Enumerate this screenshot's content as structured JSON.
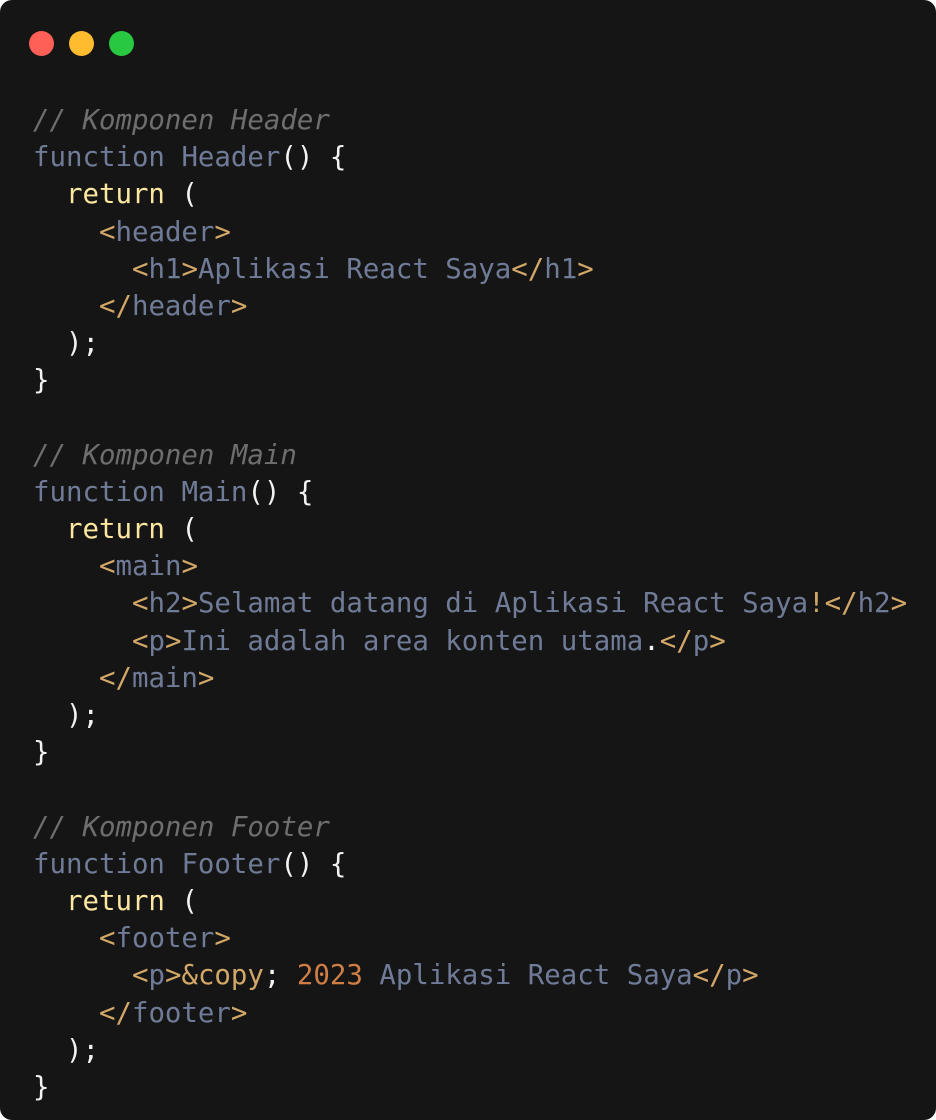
{
  "window": {
    "traffic_lights": [
      {
        "name": "close",
        "color": "#fe5f57"
      },
      {
        "name": "minimize",
        "color": "#febc2e"
      },
      {
        "name": "zoom",
        "color": "#28c840"
      }
    ]
  },
  "code": {
    "lines": [
      [
        {
          "t": "// Komponen Header",
          "c": "comment"
        }
      ],
      [
        {
          "t": "function",
          "c": "keyword"
        },
        {
          "t": " ",
          "c": "punc"
        },
        {
          "t": "Header",
          "c": "fn"
        },
        {
          "t": "() {",
          "c": "punc"
        }
      ],
      [
        {
          "t": "  ",
          "c": "punc"
        },
        {
          "t": "return",
          "c": "return"
        },
        {
          "t": " (",
          "c": "punc"
        }
      ],
      [
        {
          "t": "    ",
          "c": "punc"
        },
        {
          "t": "<",
          "c": "tag-punc"
        },
        {
          "t": "header",
          "c": "tag-name"
        },
        {
          "t": ">",
          "c": "tag-punc"
        }
      ],
      [
        {
          "t": "      ",
          "c": "punc"
        },
        {
          "t": "<",
          "c": "tag-punc"
        },
        {
          "t": "h1",
          "c": "tag-name"
        },
        {
          "t": ">",
          "c": "tag-punc"
        },
        {
          "t": "Aplikasi React Saya",
          "c": "text"
        },
        {
          "t": "</",
          "c": "tag-punc"
        },
        {
          "t": "h1",
          "c": "tag-name"
        },
        {
          "t": ">",
          "c": "tag-punc"
        }
      ],
      [
        {
          "t": "    ",
          "c": "punc"
        },
        {
          "t": "</",
          "c": "tag-punc"
        },
        {
          "t": "header",
          "c": "tag-name"
        },
        {
          "t": ">",
          "c": "tag-punc"
        }
      ],
      [
        {
          "t": "  );",
          "c": "punc"
        }
      ],
      [
        {
          "t": "}",
          "c": "punc"
        }
      ],
      [],
      [
        {
          "t": "// Komponen Main",
          "c": "comment"
        }
      ],
      [
        {
          "t": "function",
          "c": "keyword"
        },
        {
          "t": " ",
          "c": "punc"
        },
        {
          "t": "Main",
          "c": "fn"
        },
        {
          "t": "() {",
          "c": "punc"
        }
      ],
      [
        {
          "t": "  ",
          "c": "punc"
        },
        {
          "t": "return",
          "c": "return"
        },
        {
          "t": " (",
          "c": "punc"
        }
      ],
      [
        {
          "t": "    ",
          "c": "punc"
        },
        {
          "t": "<",
          "c": "tag-punc"
        },
        {
          "t": "main",
          "c": "tag-name"
        },
        {
          "t": ">",
          "c": "tag-punc"
        }
      ],
      [
        {
          "t": "      ",
          "c": "punc"
        },
        {
          "t": "<",
          "c": "tag-punc"
        },
        {
          "t": "h2",
          "c": "tag-name"
        },
        {
          "t": ">",
          "c": "tag-punc"
        },
        {
          "t": "Selamat datang di Aplikasi React Saya",
          "c": "text"
        },
        {
          "t": "!",
          "c": "entity"
        },
        {
          "t": "</",
          "c": "tag-punc"
        },
        {
          "t": "h2",
          "c": "tag-name"
        },
        {
          "t": ">",
          "c": "tag-punc"
        }
      ],
      [
        {
          "t": "      ",
          "c": "punc"
        },
        {
          "t": "<",
          "c": "tag-punc"
        },
        {
          "t": "p",
          "c": "tag-name"
        },
        {
          "t": ">",
          "c": "tag-punc"
        },
        {
          "t": "Ini adalah area konten utama",
          "c": "text"
        },
        {
          "t": ".",
          "c": "punc"
        },
        {
          "t": "</",
          "c": "tag-punc"
        },
        {
          "t": "p",
          "c": "tag-name"
        },
        {
          "t": ">",
          "c": "tag-punc"
        }
      ],
      [
        {
          "t": "    ",
          "c": "punc"
        },
        {
          "t": "</",
          "c": "tag-punc"
        },
        {
          "t": "main",
          "c": "tag-name"
        },
        {
          "t": ">",
          "c": "tag-punc"
        }
      ],
      [
        {
          "t": "  );",
          "c": "punc"
        }
      ],
      [
        {
          "t": "}",
          "c": "punc"
        }
      ],
      [],
      [
        {
          "t": "// Komponen Footer",
          "c": "comment"
        }
      ],
      [
        {
          "t": "function",
          "c": "keyword"
        },
        {
          "t": " ",
          "c": "punc"
        },
        {
          "t": "Footer",
          "c": "fn"
        },
        {
          "t": "() {",
          "c": "punc"
        }
      ],
      [
        {
          "t": "  ",
          "c": "punc"
        },
        {
          "t": "return",
          "c": "return"
        },
        {
          "t": " (",
          "c": "punc"
        }
      ],
      [
        {
          "t": "    ",
          "c": "punc"
        },
        {
          "t": "<",
          "c": "tag-punc"
        },
        {
          "t": "footer",
          "c": "tag-name"
        },
        {
          "t": ">",
          "c": "tag-punc"
        }
      ],
      [
        {
          "t": "      ",
          "c": "punc"
        },
        {
          "t": "<",
          "c": "tag-punc"
        },
        {
          "t": "p",
          "c": "tag-name"
        },
        {
          "t": ">",
          "c": "tag-punc"
        },
        {
          "t": "&copy",
          "c": "entity"
        },
        {
          "t": "; ",
          "c": "punc"
        },
        {
          "t": "2023",
          "c": "number"
        },
        {
          "t": " Aplikasi React Saya",
          "c": "text"
        },
        {
          "t": "</",
          "c": "tag-punc"
        },
        {
          "t": "p",
          "c": "tag-name"
        },
        {
          "t": ">",
          "c": "tag-punc"
        }
      ],
      [
        {
          "t": "    ",
          "c": "punc"
        },
        {
          "t": "</",
          "c": "tag-punc"
        },
        {
          "t": "footer",
          "c": "tag-name"
        },
        {
          "t": ">",
          "c": "tag-punc"
        }
      ],
      [
        {
          "t": "  );",
          "c": "punc"
        }
      ],
      [
        {
          "t": "}",
          "c": "punc"
        }
      ]
    ]
  }
}
